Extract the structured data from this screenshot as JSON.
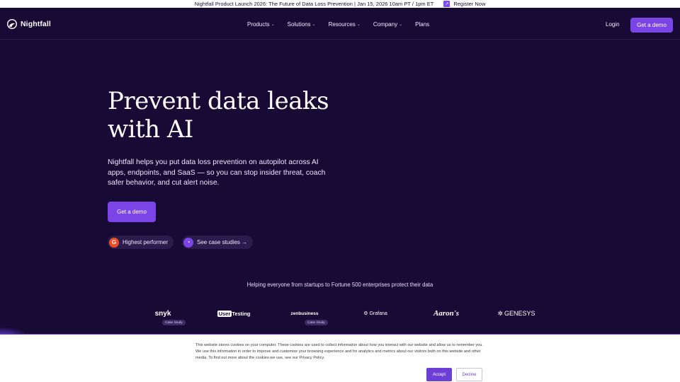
{
  "announcement": {
    "text": "Nightfall Product Launch 2026: The Future of Data Loss Prevention | Jan 15, 2026 10am PT / 1pm ET",
    "cta": "Register Now",
    "cta_icon": "arrow-up-right-icon"
  },
  "nav": {
    "brand": "Nightfall",
    "items": [
      {
        "label": "Products",
        "dropdown": true
      },
      {
        "label": "Solutions",
        "dropdown": true
      },
      {
        "label": "Resources",
        "dropdown": true
      },
      {
        "label": "Company",
        "dropdown": true
      },
      {
        "label": "Plans",
        "dropdown": false
      }
    ],
    "login": "Login",
    "cta": "Get a demo"
  },
  "hero": {
    "title_line1": "Prevent data leaks",
    "title_line2": "with AI",
    "description": "Nightfall helps you put data loss prevention on autopilot across AI apps, endpoints, and SaaS — so you can stop insider threat, coach safer behavior, and cut alert noise.",
    "cta": "Get a demo",
    "badges": [
      {
        "label": "Highest performer",
        "icon": "g2-icon"
      },
      {
        "label": "See case studies →",
        "icon": "nightfall-icon"
      }
    ]
  },
  "customers": {
    "heading": "Helping everyone from startups to Fortune 500 enterprises protect their data",
    "logos": [
      {
        "name": "snyk",
        "tag": "Case Study"
      },
      {
        "name": "UserTesting",
        "tag": ""
      },
      {
        "name": "zenbusiness",
        "tag": "Case Study"
      },
      {
        "name": "Grafana",
        "tag": ""
      },
      {
        "name": "Aaron's",
        "tag": ""
      },
      {
        "name": "GENESYS",
        "tag": ""
      }
    ]
  },
  "cookie": {
    "text": "This website stores cookies on your computer. These cookies are used to collect information about how you interact with our website and allow us to remember you. We use this information in order to improve and customize your browsing experience and for analytics and metrics about our visitors both on this website and other media. To find out more about the cookies we use, see our Privacy Policy.",
    "accept": "Accept",
    "decline": "Decline"
  },
  "colors": {
    "background": "#170a35",
    "accent": "#7b44e6"
  }
}
